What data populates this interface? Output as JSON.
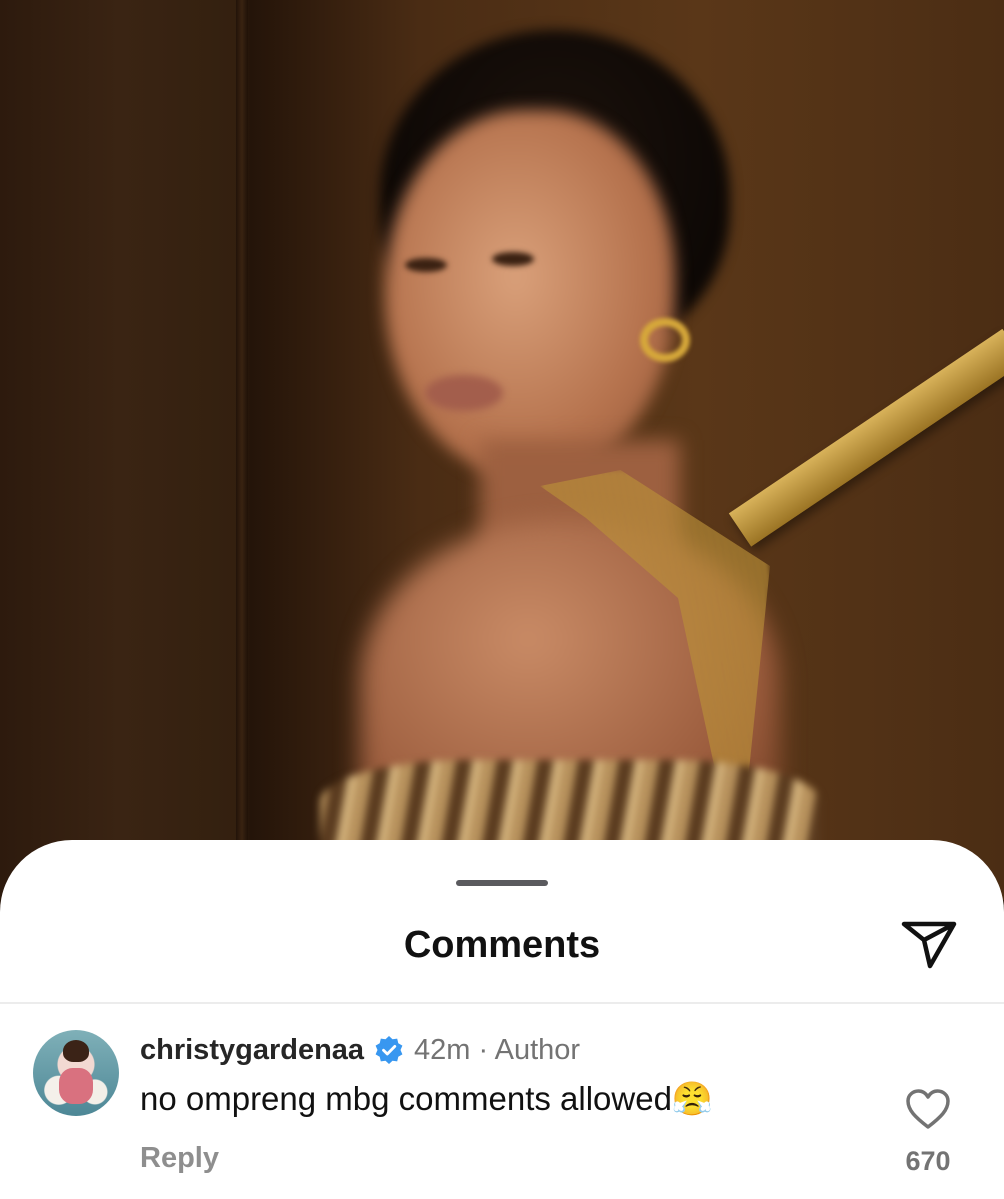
{
  "sheet": {
    "title": "Comments",
    "share_icon": "paper-plane-icon"
  },
  "comments": [
    {
      "username": "christygardenaa",
      "verified": true,
      "meta": "42m · Author",
      "text": "no ompreng mbg comments allowed😤",
      "reply_label": "Reply",
      "like_icon": "heart-outline-icon",
      "like_count": "670"
    }
  ],
  "colors": {
    "verified_badge": "#3897f0",
    "muted_text": "#737373",
    "sheet_bg": "#ffffff"
  }
}
